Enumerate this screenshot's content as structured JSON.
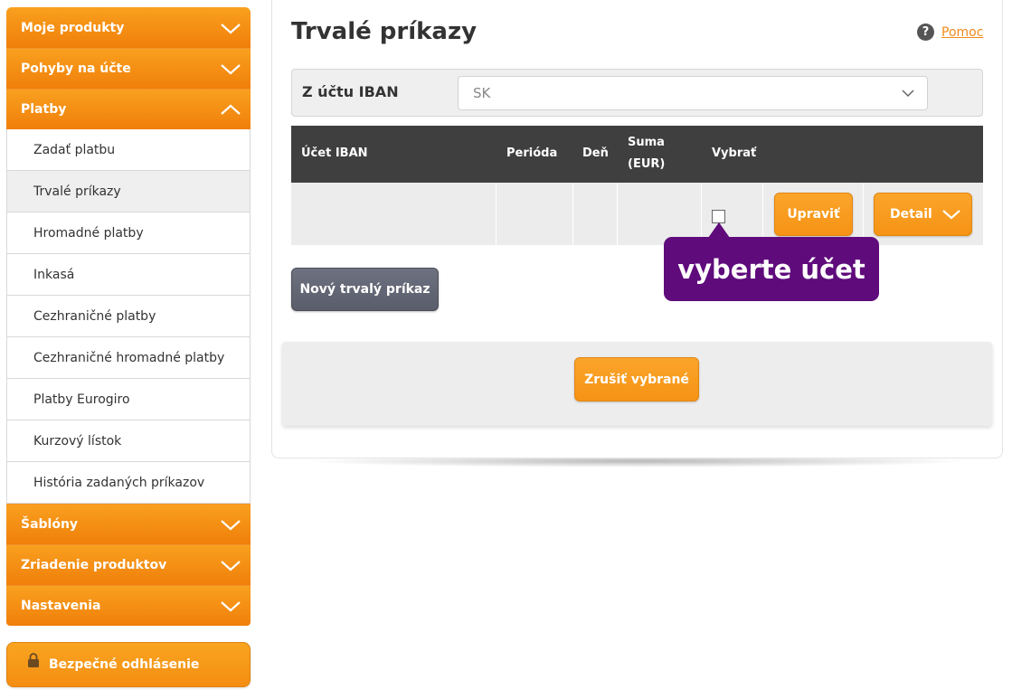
{
  "sidebar": {
    "groups_top": [
      {
        "label": "Moje produkty"
      },
      {
        "label": "Pohyby na účte"
      },
      {
        "label": "Platby"
      }
    ],
    "payments_items": [
      {
        "label": "Zadať platbu"
      },
      {
        "label": "Trvalé príkazy"
      },
      {
        "label": "Hromadné platby"
      },
      {
        "label": "Inkasá"
      },
      {
        "label": "Cezhraničné platby"
      },
      {
        "label": "Cezhraničné hromadné platby"
      },
      {
        "label": "Platby Eurogiro"
      },
      {
        "label": "Kurzový lístok"
      },
      {
        "label": "História zadaných príkazov"
      }
    ],
    "groups_bottom": [
      {
        "label": "Šablóny"
      },
      {
        "label": "Zriadenie produktov"
      },
      {
        "label": "Nastavenia"
      }
    ],
    "logout_label": "Bezpečné odhlásenie"
  },
  "page": {
    "title": "Trvalé príkazy",
    "help_label": "Pomoc"
  },
  "iban_filter": {
    "label": "Z účtu IBAN",
    "value": "SK"
  },
  "table": {
    "columns": {
      "iban": "Účet IBAN",
      "period": "Perióda",
      "day": "Deň",
      "amount_line1": "Suma",
      "amount_line2": "(EUR)",
      "select": "Vybrať"
    },
    "row_actions": {
      "edit": "Upraviť",
      "detail": "Detail"
    }
  },
  "tooltip": "vyberte účet",
  "buttons": {
    "new_order": "Nový trvalý príkaz",
    "cancel_selected": "Zrušiť vybrané"
  },
  "colors": {
    "accent_orange": "#f7931e",
    "tooltip_purple": "#5f0b7c",
    "table_header": "#3f3f3f"
  }
}
